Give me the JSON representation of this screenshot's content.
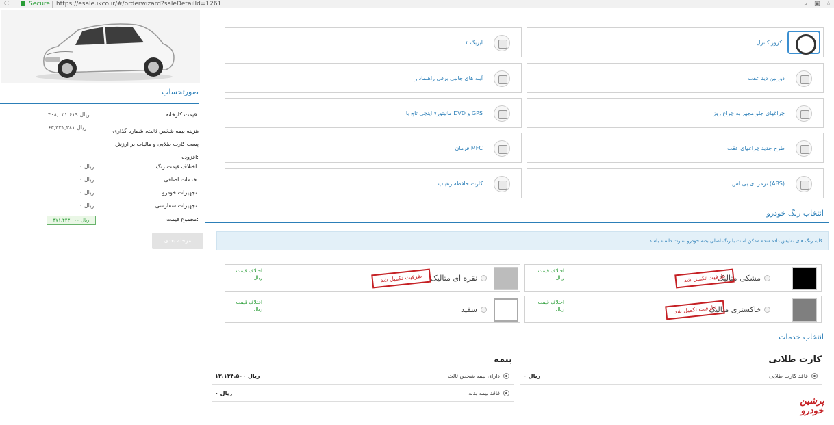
{
  "browser": {
    "secure_label": "Secure",
    "url": "https://esale.ikco.ir/#/orderwizard?saleDetailId=1261"
  },
  "sidebar": {
    "title": "صورتحساب",
    "rows": [
      {
        "label": "قیمت کارخانه:",
        "value": "۴۰۸,۰۲۱,۶۱۹ ریال"
      },
      {
        "label": "هزینه بیمه شخص ثالث، شماره گذاری، پست کارت طلایی و مالیات بر ارزش افزوده:",
        "value": "۶۳,۴۲۱,۳۸۱ ریال"
      },
      {
        "label": "اختلاف قیمت رنگ:",
        "value": "۰ ریال"
      },
      {
        "label": "خدمات اضافی:",
        "value": "۰ ریال"
      },
      {
        "label": "تجهیزات خودرو:",
        "value": "۰ ریال"
      },
      {
        "label": "تجهیزات سفارشی:",
        "value": "۰ ریال"
      }
    ],
    "total_label": "مجموع قیمت:",
    "total_value": "۴۷۱,۴۴۳,۰۰۰ ریال",
    "next_button": "مرحله بعدی"
  },
  "options": [
    {
      "label": "کروز کنترل",
      "col": "right",
      "row": 0
    },
    {
      "label": "۲ ایربگ",
      "col": "left",
      "row": 0
    },
    {
      "label": "دوربین دید عقب",
      "col": "right",
      "row": 1
    },
    {
      "label": "آینه های جانبی برقی راهنمادار",
      "col": "left",
      "row": 1
    },
    {
      "label": "چراغهای جلو مجهز به چراغ روز",
      "col": "right",
      "row": 2
    },
    {
      "label": "مانیتور۷ اینچی تاچ با DVD و GPS",
      "col": "left",
      "row": 2
    },
    {
      "label": "طرح جدید چراغهای عقب",
      "col": "right",
      "row": 3
    },
    {
      "label": "فرمان MFC",
      "col": "left",
      "row": 3
    },
    {
      "label": "ترمز ای بی اس (ABS)",
      "col": "right",
      "row": 4
    },
    {
      "label": "کارت حافظه رهیاب",
      "col": "left",
      "row": 4
    }
  ],
  "color_section": {
    "title": "انتخاب رنگ خودرو",
    "notice": "کلیه رنگ های نمایش داده شده ممکن است با رنگ اصلی بدنه خودرو تفاوت داشته باشد",
    "diff_label": "اختلاف قیمت",
    "diff_value": "۰ ریال",
    "stamp_text": "ظرفیت تکمیل شد",
    "colors": [
      {
        "name": "مشکی متالیک",
        "swatch": "#000000",
        "full": true
      },
      {
        "name": "نقره ای متالیک",
        "swatch": "#bcbcbc",
        "full": true
      },
      {
        "name": "خاکستری متالیک",
        "swatch": "#7f7f7f",
        "full": true
      },
      {
        "name": "سفید",
        "swatch": "#ffffff",
        "full": false
      }
    ]
  },
  "services": {
    "title": "انتخاب خدمات",
    "golden_card": {
      "title": "کارت طلایی",
      "items": [
        {
          "name": "فاقد کارت طلایی",
          "price": "۰ ریال"
        }
      ]
    },
    "insurance": {
      "title": "بیمه",
      "items": [
        {
          "name": "دارای بیمه شخص ثالث",
          "price": "۱۳,۱۳۴,۵۰۰ ریال"
        },
        {
          "name": "فاقد بیمه بدنه",
          "price": "۰ ریال"
        }
      ]
    }
  },
  "watermark": "پرشین خودرو",
  "accent_color": "#2c7fb8"
}
